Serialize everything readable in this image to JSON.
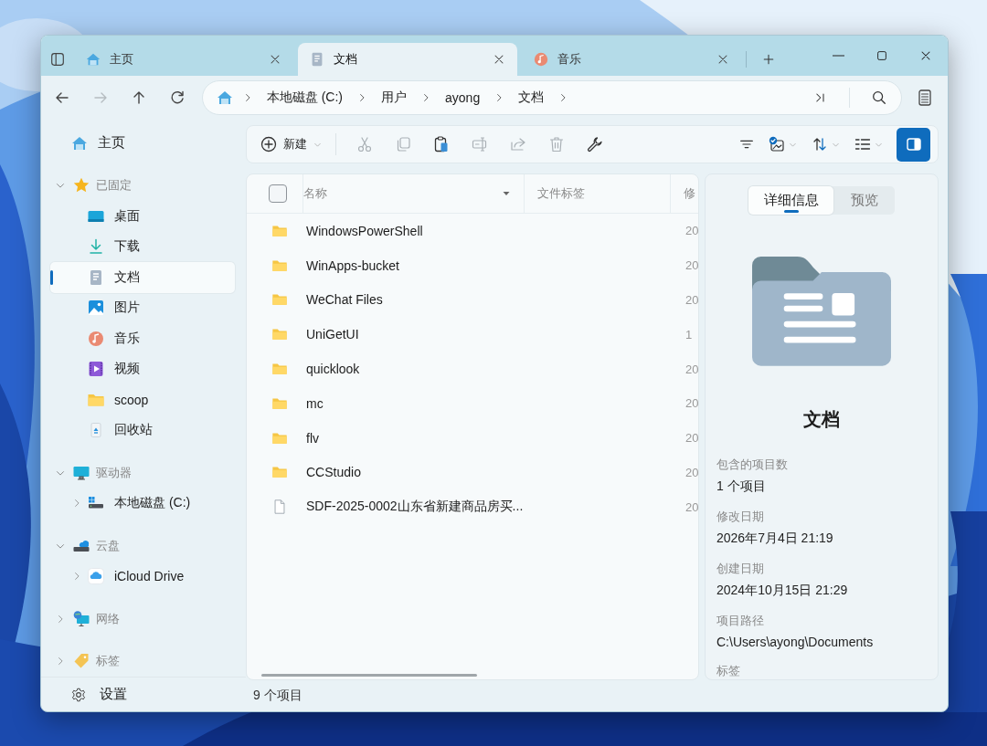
{
  "window": {
    "tabs": [
      {
        "label": "主页",
        "selected": false
      },
      {
        "label": "文档",
        "selected": true
      },
      {
        "label": "音乐",
        "selected": false
      }
    ]
  },
  "navigation": {
    "buttons": [
      {
        "disabled": false
      },
      {
        "disabled": true
      },
      {
        "disabled": false
      },
      {
        "disabled": false
      }
    ],
    "breadcrumbs": [
      "本地磁盘 (C:)",
      "用户",
      "ayong",
      "文档"
    ]
  },
  "toolbar": {
    "new_button": "新建",
    "actions": [
      {
        "disabled": true
      },
      {
        "disabled": true
      },
      {
        "disabled": false
      },
      {
        "disabled": true
      },
      {
        "disabled": true
      },
      {
        "disabled": true
      },
      {
        "disabled": false
      }
    ],
    "details_pane": {
      "on": true
    }
  },
  "sidebar": {
    "home": "主页",
    "sections": [
      {
        "label": "已固定",
        "expanded": true,
        "children": [
          {
            "label": "桌面",
            "selected": false
          },
          {
            "label": "下载",
            "selected": false
          },
          {
            "label": "文档",
            "selected": true
          },
          {
            "label": "图片",
            "selected": false
          },
          {
            "label": "音乐",
            "selected": false
          },
          {
            "label": "视频",
            "selected": false
          },
          {
            "label": "scoop",
            "selected": false
          },
          {
            "label": "回收站",
            "selected": false
          }
        ]
      },
      {
        "label": "驱动器",
        "expanded": true,
        "children": [
          {
            "label": "本地磁盘 (C:)",
            "selected": false,
            "expanded": false
          }
        ]
      },
      {
        "label": "云盘",
        "expanded": true,
        "children": [
          {
            "label": "iCloud Drive",
            "selected": false,
            "expanded": false
          }
        ]
      },
      {
        "label": "网络",
        "expanded": false
      },
      {
        "label": "标签",
        "expanded": false
      }
    ],
    "settings": "设置"
  },
  "file_list": {
    "select_all": {
      "checked": false
    },
    "columns": [
      "名称",
      "文件标签",
      "修"
    ],
    "rows": [
      {
        "kind": "folder",
        "name": "WindowsPowerShell",
        "modified": "20"
      },
      {
        "kind": "folder",
        "name": "WinApps-bucket",
        "modified": "20"
      },
      {
        "kind": "folder",
        "name": "WeChat Files",
        "modified": "20"
      },
      {
        "kind": "folder",
        "name": "UniGetUI",
        "modified": "1"
      },
      {
        "kind": "folder",
        "name": "quicklook",
        "modified": "20"
      },
      {
        "kind": "folder",
        "name": "mc",
        "modified": "20"
      },
      {
        "kind": "folder",
        "name": "flv",
        "modified": "20"
      },
      {
        "kind": "folder",
        "name": "CCStudio",
        "modified": "20"
      },
      {
        "kind": "file",
        "name": "SDF-2025-0002山东省新建商品房买...",
        "modified": "20"
      }
    ]
  },
  "details": {
    "tabs": [
      {
        "label": "详细信息",
        "selected": true
      },
      {
        "label": "预览",
        "selected": false
      }
    ],
    "title": "文档",
    "properties": [
      {
        "label": "包含的项目数",
        "value": "1 个项目"
      },
      {
        "label": "修改日期",
        "value": "2026年7月4日 21:19"
      },
      {
        "label": "创建日期",
        "value": "2024年10月15日 21:29"
      },
      {
        "label": "项目路径",
        "value": "C:\\Users\\ayong\\Documents"
      },
      {
        "label": "标签"
      }
    ]
  },
  "status_bar": "9 个项目"
}
